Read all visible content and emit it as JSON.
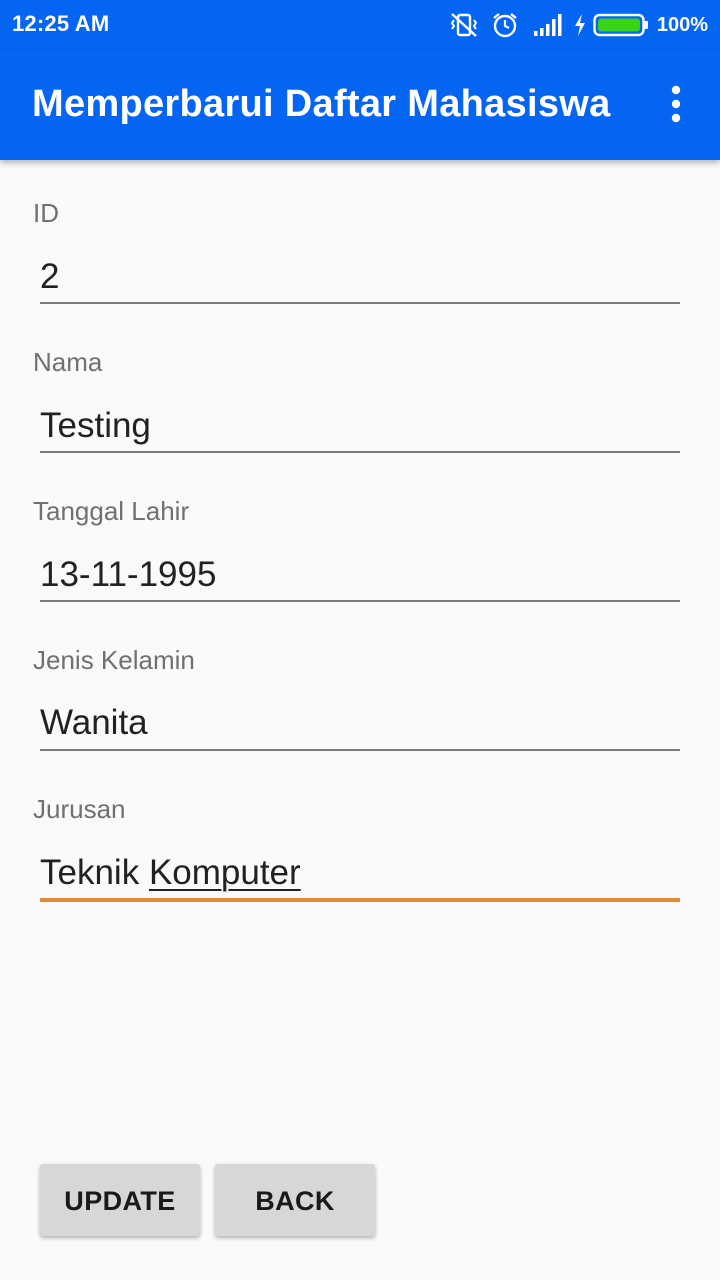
{
  "status_bar": {
    "time": "12:25 AM",
    "battery_percent": "100%",
    "icons": [
      "vibrate-icon",
      "alarm-icon",
      "signal-icon",
      "charging-icon",
      "battery-icon"
    ]
  },
  "app_bar": {
    "title": "Memperbarui Daftar Mahasiswa",
    "menu_icon": "more-vert-icon"
  },
  "form": {
    "fields": [
      {
        "label": "ID",
        "value": "2"
      },
      {
        "label": "Nama",
        "value": "Testing"
      },
      {
        "label": "Tanggal Lahir",
        "value": "13-11-1995"
      },
      {
        "label": "Jenis Kelamin",
        "value": "Wanita"
      },
      {
        "label": "Jurusan",
        "value_part1": "Teknik ",
        "value_part2": "Komputer",
        "focused": true
      }
    ]
  },
  "buttons": {
    "update_label": "UPDATE",
    "back_label": "BACK"
  },
  "colors": {
    "primary": "#0465f2",
    "focus_underline": "#e08a36",
    "background": "#fafafa",
    "button": "#d6d7d7"
  }
}
